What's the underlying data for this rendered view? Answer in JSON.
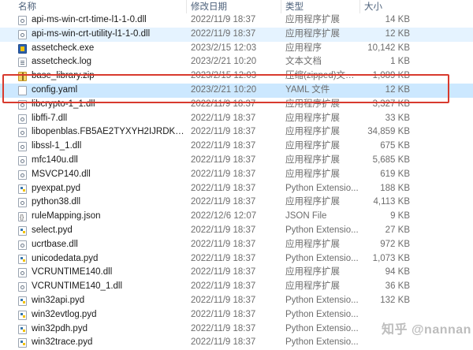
{
  "columns": {
    "name": "名称",
    "modified": "修改日期",
    "type": "类型",
    "size": "大小"
  },
  "files": [
    {
      "name": "api-ms-win-crt-time-l1-1-0.dll",
      "modified": "2022/11/9 18:37",
      "type": "应用程序扩展",
      "size": "14 KB",
      "icon": "dll-icon"
    },
    {
      "name": "api-ms-win-crt-utility-l1-1-0.dll",
      "modified": "2022/11/9 18:37",
      "type": "应用程序扩展",
      "size": "12 KB",
      "icon": "dll-icon"
    },
    {
      "name": "assetcheck.exe",
      "modified": "2023/2/15 12:03",
      "type": "应用程序",
      "size": "10,142 KB",
      "icon": "exe-icon"
    },
    {
      "name": "assetcheck.log",
      "modified": "2023/2/21 10:20",
      "type": "文本文档",
      "size": "1 KB",
      "icon": "text-file-icon"
    },
    {
      "name": "base_library.zip",
      "modified": "2023/2/15 12:03",
      "type": "压缩(zipped)文件...",
      "size": "1,089 KB",
      "icon": "zip-icon"
    },
    {
      "name": "config.yaml",
      "modified": "2023/2/21 10:20",
      "type": "YAML 文件",
      "size": "12 KB",
      "icon": "file-icon"
    },
    {
      "name": "libcrypto-1_1.dll",
      "modified": "2022/11/9 18:37",
      "type": "应用程序扩展",
      "size": "3,327 KB",
      "icon": "dll-icon"
    },
    {
      "name": "libffi-7.dll",
      "modified": "2022/11/9 18:37",
      "type": "应用程序扩展",
      "size": "33 KB",
      "icon": "dll-icon"
    },
    {
      "name": "libopenblas.FB5AE2TYXYH2IJRDKGD...",
      "modified": "2022/11/9 18:37",
      "type": "应用程序扩展",
      "size": "34,859 KB",
      "icon": "dll-icon"
    },
    {
      "name": "libssl-1_1.dll",
      "modified": "2022/11/9 18:37",
      "type": "应用程序扩展",
      "size": "675 KB",
      "icon": "dll-icon"
    },
    {
      "name": "mfc140u.dll",
      "modified": "2022/11/9 18:37",
      "type": "应用程序扩展",
      "size": "5,685 KB",
      "icon": "dll-icon"
    },
    {
      "name": "MSVCP140.dll",
      "modified": "2022/11/9 18:37",
      "type": "应用程序扩展",
      "size": "619 KB",
      "icon": "dll-icon"
    },
    {
      "name": "pyexpat.pyd",
      "modified": "2022/11/9 18:37",
      "type": "Python Extensio...",
      "size": "188 KB",
      "icon": "python-file-icon"
    },
    {
      "name": "python38.dll",
      "modified": "2022/11/9 18:37",
      "type": "应用程序扩展",
      "size": "4,113 KB",
      "icon": "dll-icon"
    },
    {
      "name": "ruleMapping.json",
      "modified": "2022/12/6 12:07",
      "type": "JSON File",
      "size": "9 KB",
      "icon": "json-file-icon"
    },
    {
      "name": "select.pyd",
      "modified": "2022/11/9 18:37",
      "type": "Python Extensio...",
      "size": "27 KB",
      "icon": "python-file-icon"
    },
    {
      "name": "ucrtbase.dll",
      "modified": "2022/11/9 18:37",
      "type": "应用程序扩展",
      "size": "972 KB",
      "icon": "dll-icon"
    },
    {
      "name": "unicodedata.pyd",
      "modified": "2022/11/9 18:37",
      "type": "Python Extensio...",
      "size": "1,073 KB",
      "icon": "python-file-icon"
    },
    {
      "name": "VCRUNTIME140.dll",
      "modified": "2022/11/9 18:37",
      "type": "应用程序扩展",
      "size": "94 KB",
      "icon": "dll-icon"
    },
    {
      "name": "VCRUNTIME140_1.dll",
      "modified": "2022/11/9 18:37",
      "type": "应用程序扩展",
      "size": "36 KB",
      "icon": "dll-icon"
    },
    {
      "name": "win32api.pyd",
      "modified": "2022/11/9 18:37",
      "type": "Python Extensio...",
      "size": "132 KB",
      "icon": "python-file-icon"
    },
    {
      "name": "win32evtlog.pyd",
      "modified": "2022/11/9 18:37",
      "type": "Python Extensio...",
      "size": "",
      "icon": "python-file-icon"
    },
    {
      "name": "win32pdh.pyd",
      "modified": "2022/11/9 18:37",
      "type": "Python Extensio...",
      "size": "",
      "icon": "python-file-icon"
    },
    {
      "name": "win32trace.pyd",
      "modified": "2022/11/9 18:37",
      "type": "Python Extensio...",
      "size": "",
      "icon": "python-file-icon"
    }
  ],
  "selected_file": "config.yaml",
  "highlight_color": "#d83a2e",
  "selection_color": "#cce8ff",
  "watermark": "知乎 @nannan"
}
